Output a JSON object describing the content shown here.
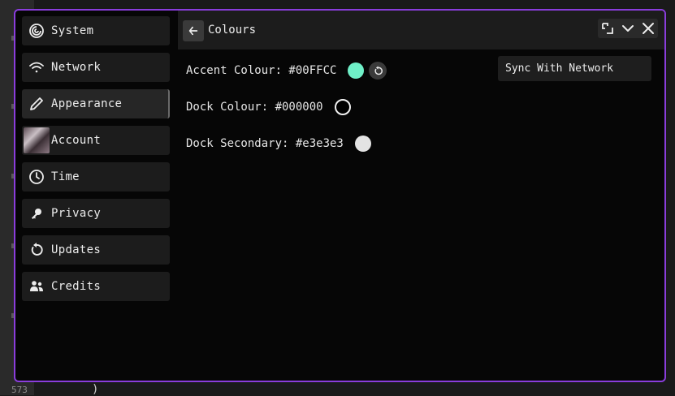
{
  "background": {
    "gutter_line_number": "573",
    "closing_paren": ")"
  },
  "sidebar": {
    "items": [
      {
        "label": "System",
        "icon": "system-icon",
        "active": false
      },
      {
        "label": "Network",
        "icon": "wifi-icon",
        "active": false
      },
      {
        "label": "Appearance",
        "icon": "pencil-icon",
        "active": true
      },
      {
        "label": "Account",
        "icon": "avatar",
        "active": false
      },
      {
        "label": "Time",
        "icon": "clock-icon",
        "active": false
      },
      {
        "label": "Privacy",
        "icon": "key-icon",
        "active": false
      },
      {
        "label": "Updates",
        "icon": "refresh-icon",
        "active": false
      },
      {
        "label": "Credits",
        "icon": "people-icon",
        "active": false
      }
    ]
  },
  "header": {
    "title": "Colours"
  },
  "settings": {
    "accent": {
      "label": "Accent Colour: #00FFCC",
      "color": "#6ff0c8"
    },
    "dock": {
      "label": "Dock Colour: #000000",
      "color": "#000000"
    },
    "dock_secondary": {
      "label": "Dock Secondary: #e3e3e3",
      "color": "#e3e3e3"
    }
  },
  "sync_button": {
    "label": "Sync With Network"
  },
  "theme": {
    "window_border": "#8a3ddc",
    "window_bg": "#060606",
    "panel_bg": "#1c1c1c"
  }
}
